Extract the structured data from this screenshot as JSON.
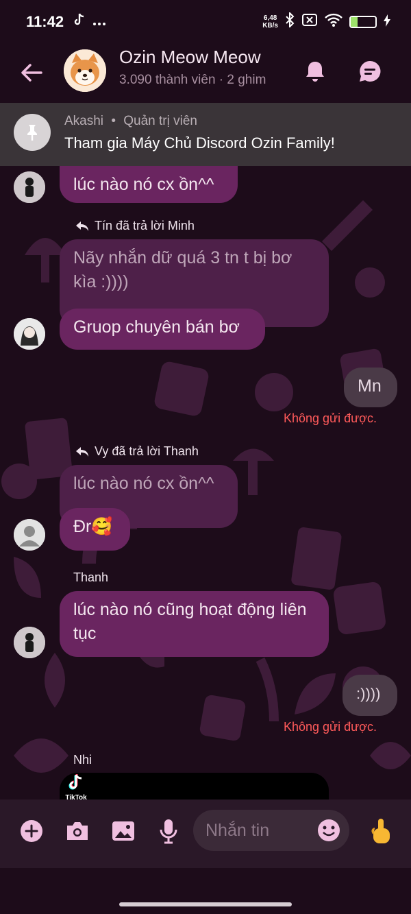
{
  "status_bar": {
    "time": "11:42",
    "left_icons": [
      "tiktok-icon",
      "more-dots-icon"
    ],
    "net_speed_value": "6,48",
    "net_speed_unit": "KB/s",
    "battery_level": "27",
    "battery_fraction": 0.27,
    "battery_color": "#9ee36b"
  },
  "header": {
    "title": "Ozin Meow Meow",
    "subtitle": "3.090 thành viên · 2 ghim",
    "avatar_icon": "shiba-dog-avatar",
    "actions": [
      "bell-icon",
      "chat-bubble-icon"
    ]
  },
  "pinned": {
    "author": "Akashi",
    "role": "Quản trị viên",
    "separator": "•",
    "text": "Tham gia Máy Chủ Discord Ozin Family!"
  },
  "messages": {
    "m1": {
      "text": "lúc nào nó cx ồn^^"
    },
    "reply1": {
      "label": "Tín đã trả lời Minh",
      "quoted": "Nãy nhắn dữ quá 3 tn t bị bơ kìa :))))"
    },
    "m2": {
      "text": "Gruop chuyên bán bơ"
    },
    "mine1": {
      "text": "Mn",
      "status": "Không gửi được."
    },
    "reply2": {
      "label": "Vy đã trả lời Thanh",
      "quoted": "lúc nào nó cx ồn^^"
    },
    "m3": {
      "text": "Đr🥰"
    },
    "sender_thanh": "Thanh",
    "m4": {
      "text": "lúc nào nó cũng hoạt động liên tục"
    },
    "mine2": {
      "text": ":))))",
      "status": "Không gửi được."
    },
    "sender_nhi": "Nhi",
    "tiktok_label": "TikTok"
  },
  "composer": {
    "placeholder": "Nhắn tin",
    "icons": [
      "add-icon",
      "camera-icon",
      "image-icon",
      "microphone-icon",
      "emoji-icon",
      "finger-emoji-icon"
    ]
  },
  "colors": {
    "background": "#1d0c1a",
    "bubble": "#6a2560",
    "bubble_reply": "#4e2049",
    "error": "#ff5a5a",
    "accent_icon": "#f0bfe0"
  }
}
